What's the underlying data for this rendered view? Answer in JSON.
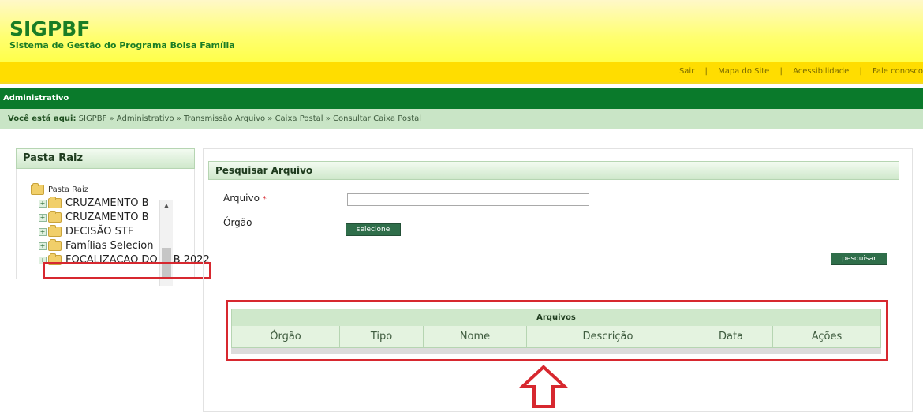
{
  "header": {
    "logo": "SIGPBF",
    "subtitle": "Sistema de Gestão do Programa Bolsa Família"
  },
  "topnav": {
    "links": [
      "Sair",
      "Mapa do Site",
      "Acessibilidade",
      "Fale conosco"
    ],
    "separator": "|"
  },
  "module": {
    "label": "Administrativo"
  },
  "breadcrumb": {
    "label": "Você está aqui:",
    "path": "SIGPBF » Administrativo » Transmissão Arquivo » Caixa Postal » Consultar Caixa Postal"
  },
  "tree": {
    "title": "Pasta Raiz",
    "root": "Pasta Raiz",
    "items": [
      "CRUZAMENTO B",
      "CRUZAMENTO B",
      "DECISÃO STF",
      "Famílias Selecion",
      "FOCALIZACAO DO PAB 2022"
    ],
    "expander": "+",
    "scroll_up": "▲"
  },
  "search": {
    "title": "Pesquisar Arquivo",
    "arquivo_label": "Arquivo",
    "required_mark": "*",
    "orgao_label": "Órgão",
    "select_button": "selecione",
    "search_button": "pesquisar"
  },
  "results": {
    "title": "Arquivos",
    "columns": [
      "Órgão",
      "Tipo",
      "Nome",
      "Descrição",
      "Data",
      "Ações"
    ]
  },
  "colors": {
    "brand_green": "#1a7d25",
    "header_yellow": "#ffff70",
    "highlight_red": "#d7282f"
  }
}
